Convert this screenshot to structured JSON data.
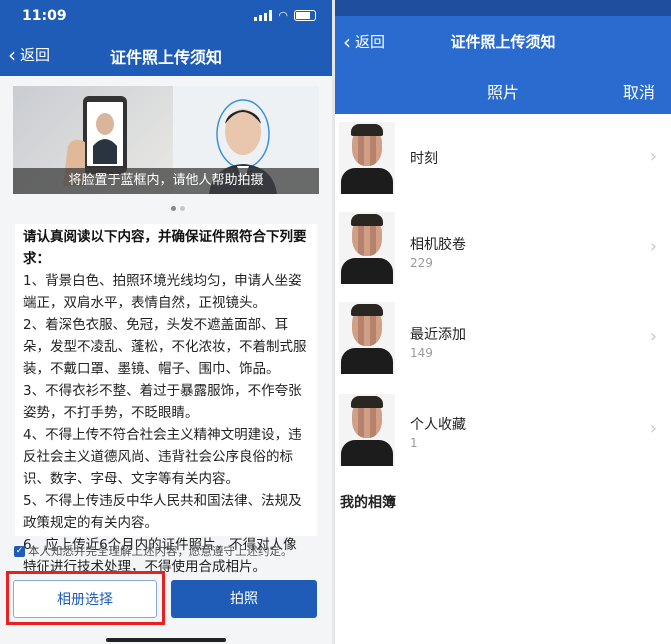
{
  "left": {
    "status": {
      "time": "11:09"
    },
    "nav": {
      "back": "返回",
      "title": "证件照上传须知"
    },
    "banner": {
      "caption": "将脸置于蓝框内，请他人帮助拍摄"
    },
    "notice": {
      "heading": "请认真阅读以下内容，并确保证件照符合下列要求：",
      "items": [
        "1、背景白色、拍照环境光线均匀，申请人坐姿端正，双肩水平，表情自然，正视镜头。",
        "2、着深色衣服、免冠，头发不遮盖面部、耳朵，发型不凌乱、蓬松，不化浓妆，不着制式服装，不戴口罩、墨镜、帽子、围巾、饰品。",
        "3、不得衣衫不整、着过于暴露服饰，不作夸张姿势，不打手势，不眨眼睛。",
        "4、不得上传不符合社会主义精神文明建设，违反社会主义道德风尚、违背社会公序良俗的标识、数字、字母、文字等有关内容。",
        "5、不得上传违反中华人民共和国法律、法规及政策规定的有关内容。",
        "6、应上传近6个月内的证件照片，不得对人像特征进行技术处理，不得使用合成相片。"
      ]
    },
    "agree_text": "本人知悉并完全理解上述内容，愿意遵守上述约定。",
    "buttons": {
      "album": "相册选择",
      "photo": "拍照"
    },
    "accent_color": "#1f5cb8",
    "highlight_color": "#e8201f"
  },
  "right": {
    "nav": {
      "back": "返回",
      "title": "证件照上传须知"
    },
    "picker": {
      "title": "照片",
      "cancel": "取消"
    },
    "albums": [
      {
        "name": "时刻",
        "count": ""
      },
      {
        "name": "相机胶卷",
        "count": "229"
      },
      {
        "name": "最近添加",
        "count": "149"
      },
      {
        "name": "个人收藏",
        "count": "1"
      }
    ],
    "section_title": "我的相簿",
    "accent_color": "#2a6bd0"
  }
}
